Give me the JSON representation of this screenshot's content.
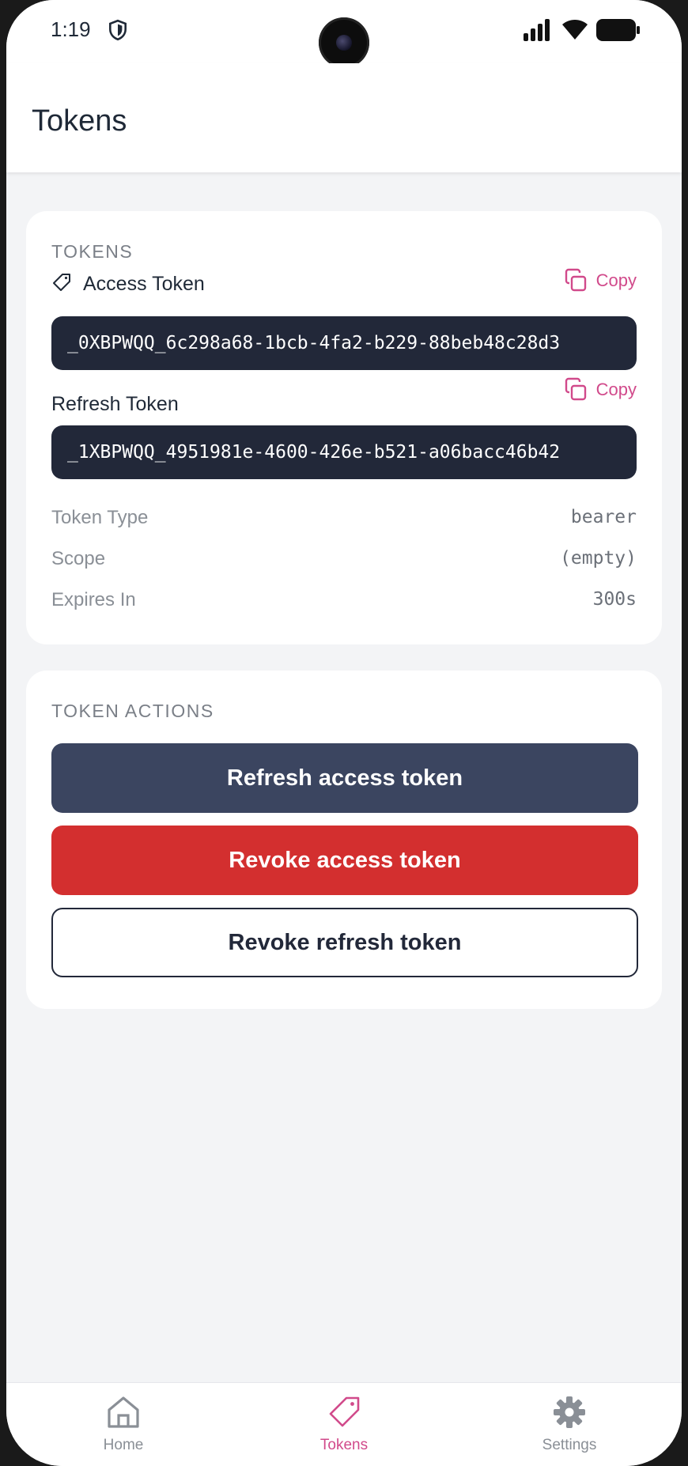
{
  "status_bar": {
    "time": "1:19"
  },
  "app_bar": {
    "title": "Tokens"
  },
  "tokens_card": {
    "section_label": "TOKENS",
    "access_token": {
      "label": "Access Token",
      "copy_label": "Copy",
      "value": "_0XBPWQQ_6c298a68-1bcb-4fa2-b229-88beb48c28d3"
    },
    "refresh_token": {
      "label": "Refresh Token",
      "copy_label": "Copy",
      "value": "_1XBPWQQ_4951981e-4600-426e-b521-a06bacc46b42"
    },
    "meta": [
      {
        "label": "Token Type",
        "value": "bearer"
      },
      {
        "label": "Scope",
        "value": "(empty)"
      },
      {
        "label": "Expires In",
        "value": "300s"
      }
    ]
  },
  "actions_card": {
    "section_label": "TOKEN ACTIONS",
    "refresh_access_label": "Refresh access token",
    "revoke_access_label": "Revoke access token",
    "revoke_refresh_label": "Revoke refresh token"
  },
  "bottom_nav": {
    "items": [
      {
        "label": "Home",
        "icon": "home-icon"
      },
      {
        "label": "Tokens",
        "icon": "tag-icon",
        "active": true
      },
      {
        "label": "Settings",
        "icon": "gear-icon"
      }
    ]
  },
  "colors": {
    "accent": "#d14a8b",
    "primary": "#3b4560",
    "danger": "#d32f2f",
    "token_bg": "#222839"
  }
}
